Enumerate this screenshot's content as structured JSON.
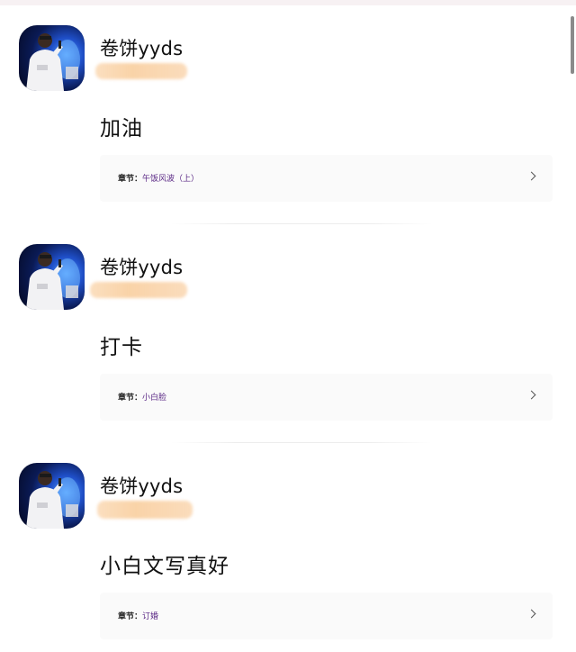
{
  "comments": [
    {
      "username": "卷饼yyds",
      "content": "加油",
      "chapter_label": "章节：",
      "chapter_name": "午饭风波（上）"
    },
    {
      "username": "卷饼yyds",
      "content": "打卡",
      "chapter_label": "章节：",
      "chapter_name": "小白脸"
    },
    {
      "username": "卷饼yyds",
      "content": "小白文写真好",
      "chapter_label": "章节：",
      "chapter_name": "订婚"
    }
  ],
  "colors": {
    "chapter_link": "#5c2a86",
    "redaction": "#f9d3a8",
    "chapter_row_bg": "#fafafa"
  },
  "icons": {
    "chevron": "chevron-right-icon"
  }
}
